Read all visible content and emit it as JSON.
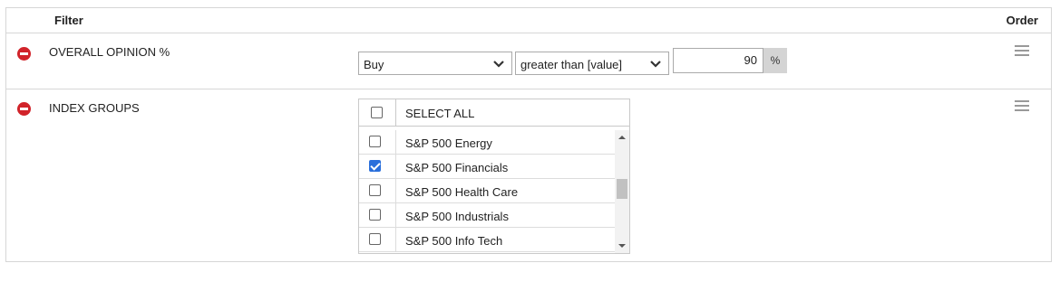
{
  "header": {
    "filter_label": "Filter",
    "order_label": "Order"
  },
  "rows": [
    {
      "label": "OVERALL OPINION %",
      "opinion_select": "Buy",
      "operator_select": "greater than [value]",
      "value": "90",
      "unit": "%"
    },
    {
      "label": "INDEX GROUPS",
      "select_all_label": "SELECT ALL",
      "items": [
        {
          "label": "S&P 500 Energy",
          "checked": false
        },
        {
          "label": "S&P 500 Financials",
          "checked": true
        },
        {
          "label": "S&P 500 Health Care",
          "checked": false
        },
        {
          "label": "S&P 500 Industrials",
          "checked": false
        },
        {
          "label": "S&P 500 Info Tech",
          "checked": false
        }
      ]
    }
  ],
  "colors": {
    "remove": "#d1232a",
    "check": "#2a6fdb"
  },
  "icons": {
    "remove": "remove-circle-icon",
    "drag": "drag-handle-icon",
    "chevron": "chevron-down-icon"
  }
}
